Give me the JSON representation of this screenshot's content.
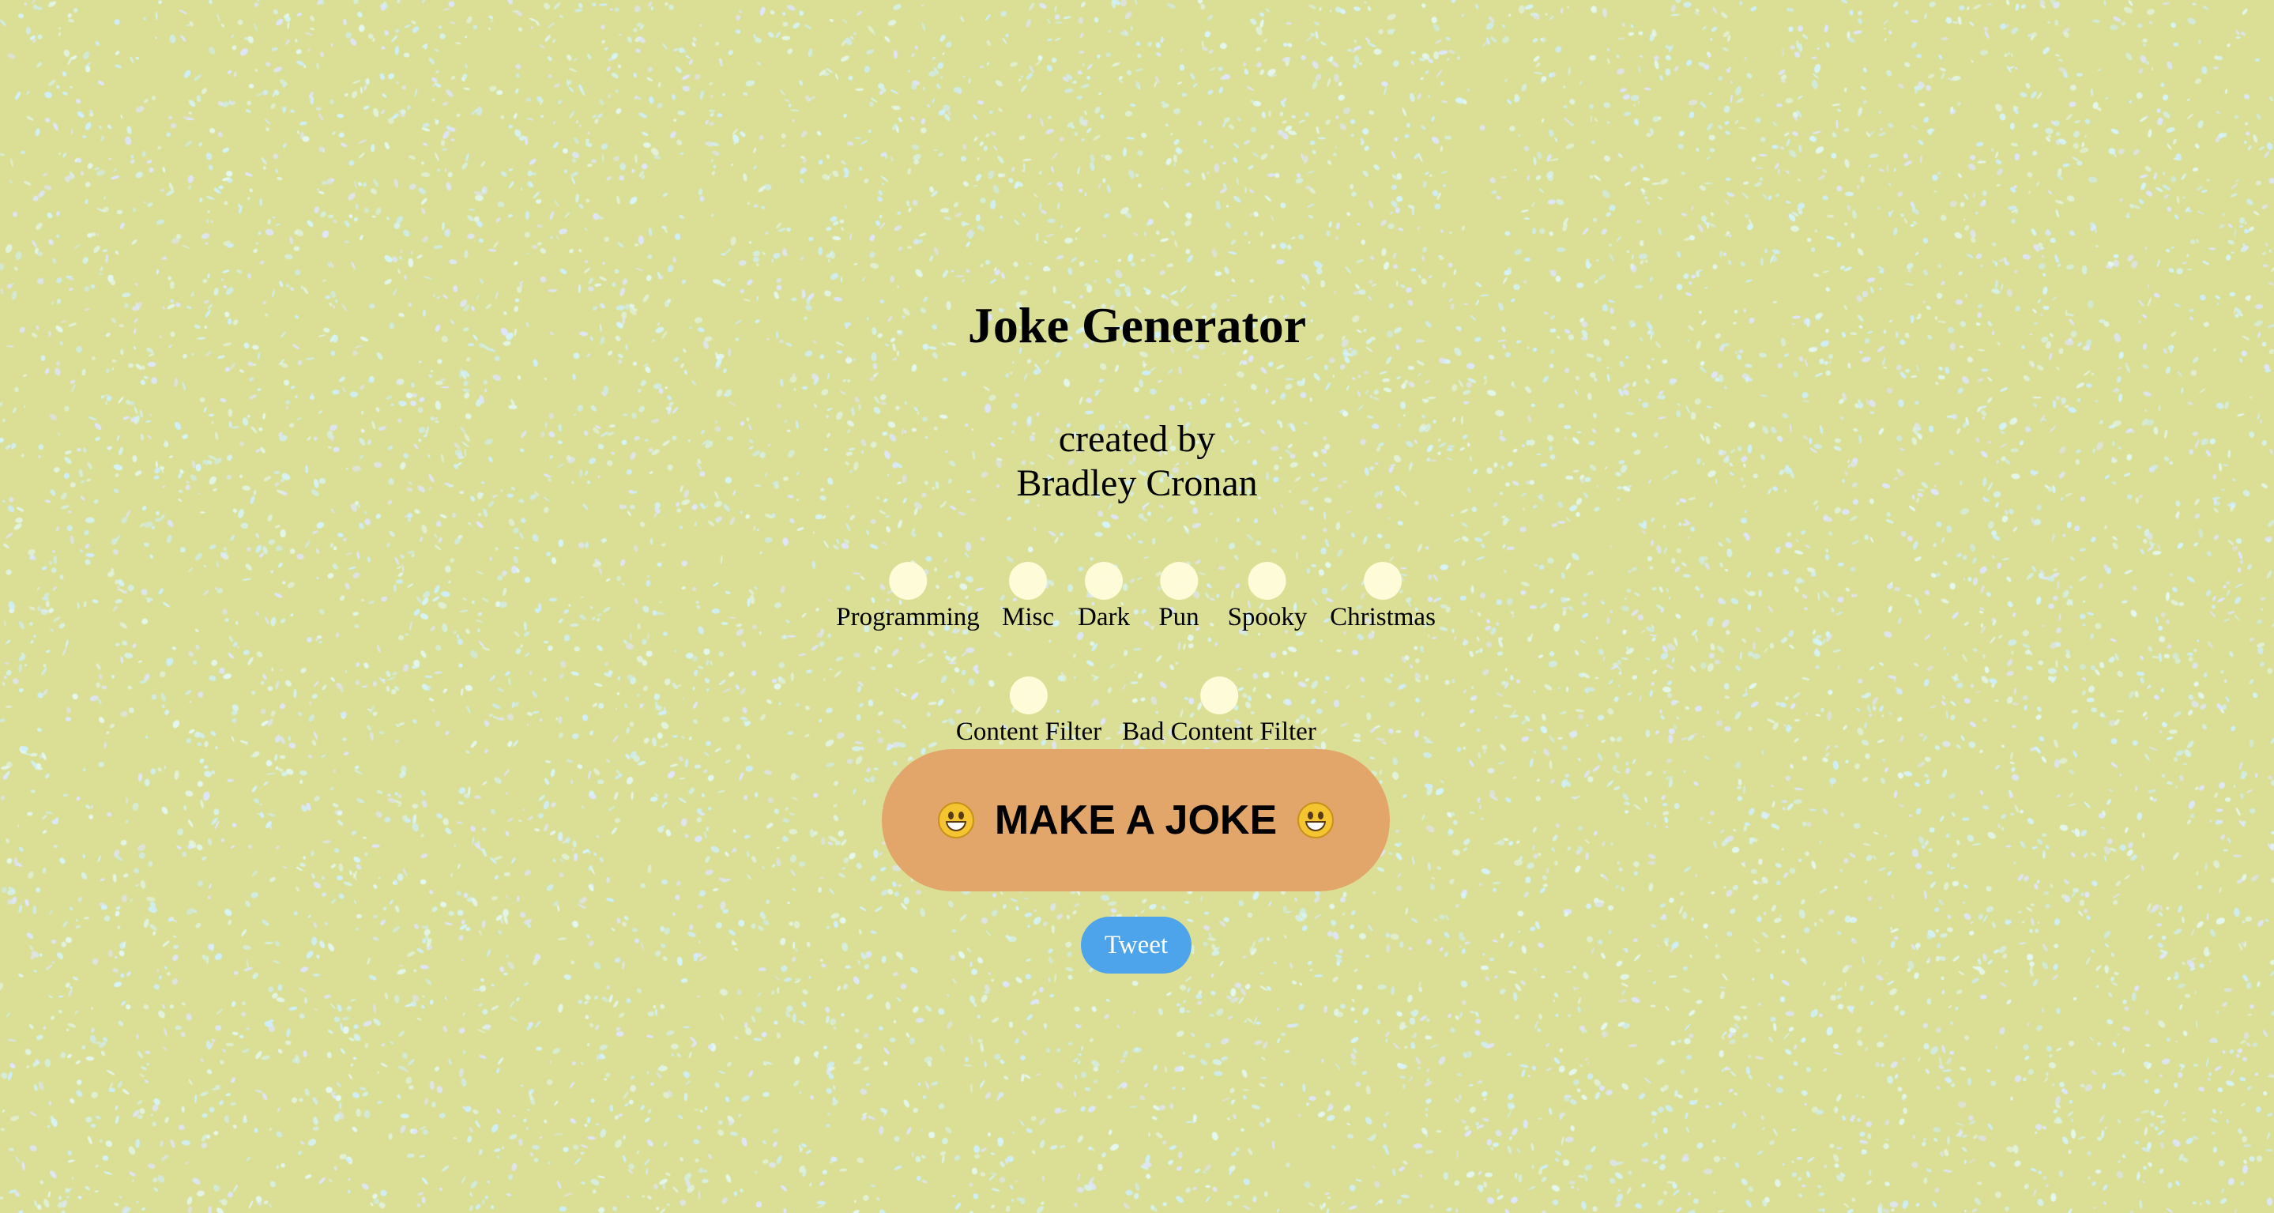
{
  "page": {
    "title": "Joke Generator",
    "credit_line1": "created by",
    "credit_line2": "Bradley Cronan",
    "background_color": "#dbdf95",
    "speckle_color": "#d6f4f8"
  },
  "categories": [
    {
      "label": "Programming"
    },
    {
      "label": "Misc"
    },
    {
      "label": "Dark"
    },
    {
      "label": "Pun"
    },
    {
      "label": "Spooky"
    },
    {
      "label": "Christmas"
    }
  ],
  "filters": [
    {
      "label": "Content Filter"
    },
    {
      "label": "Bad Content Filter"
    }
  ],
  "joke_button": {
    "label": "MAKE A JOKE",
    "icon": "grinning-face-emoji",
    "color": "#e2a56a"
  },
  "tweet_button": {
    "label": "Tweet",
    "color": "#4da4ea"
  }
}
